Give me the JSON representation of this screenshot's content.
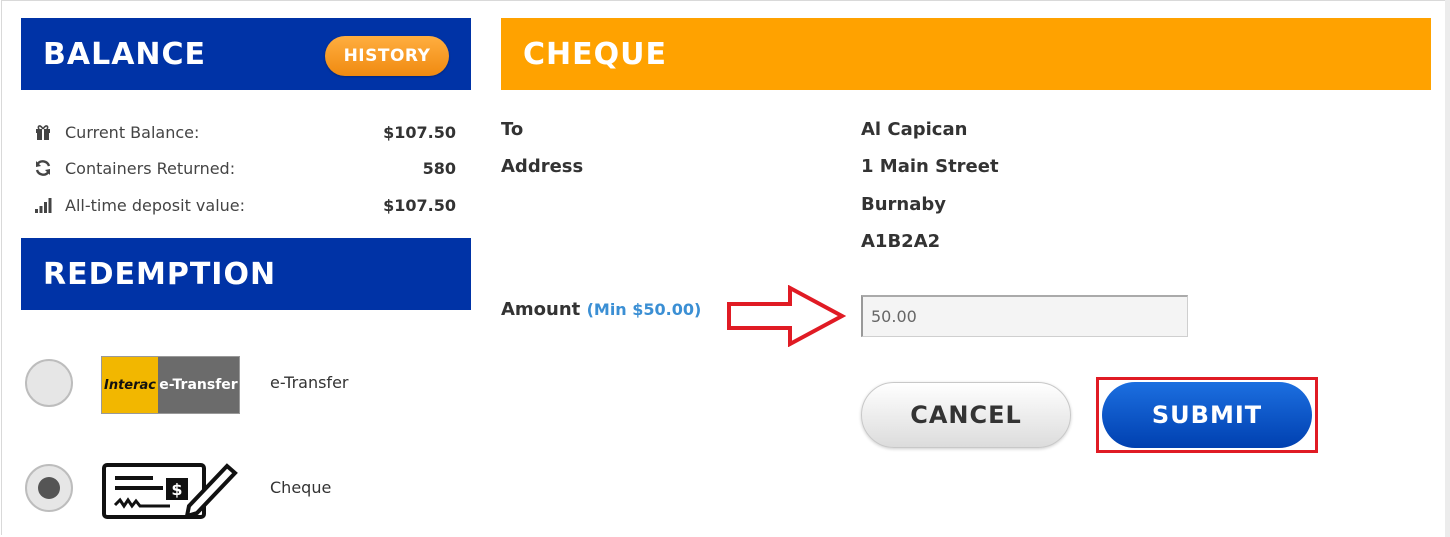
{
  "balance": {
    "title": "BALANCE",
    "history_label": "HISTORY",
    "stats": [
      {
        "icon": "gift-icon",
        "label": "Current Balance:",
        "value": "$107.50"
      },
      {
        "icon": "refresh-icon",
        "label": "Containers Returned:",
        "value": "580"
      },
      {
        "icon": "bar-chart-icon",
        "label": "All-time deposit value:",
        "value": "$107.50"
      }
    ]
  },
  "redemption": {
    "title": "REDEMPTION",
    "options": [
      {
        "label": "e-Transfer",
        "logo_left": "Interac",
        "logo_right": "e-Transfer",
        "selected": false
      },
      {
        "label": "Cheque",
        "icon": "cheque-icon",
        "selected": true
      }
    ]
  },
  "cheque": {
    "title": "CHEQUE",
    "to_label": "To",
    "to_value": "Al Capican",
    "address_label": "Address",
    "address_lines": [
      "1 Main Street",
      "Burnaby",
      "A1B2A2"
    ],
    "amount_label": "Amount",
    "amount_min": "(Min $50.00)",
    "amount_value": "50.00",
    "cancel_label": "CANCEL",
    "submit_label": "SUBMIT"
  },
  "colors": {
    "blue_header": "#0033a6",
    "orange_header": "#ffa200",
    "annotation_red": "#e01b24",
    "submit_blue": "#0050c8"
  }
}
